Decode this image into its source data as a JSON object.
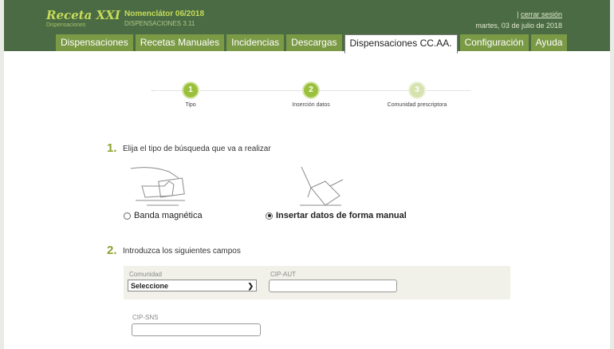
{
  "header": {
    "logo_text": "Receta XXI",
    "logo_sub": "Dispensaciones",
    "nomenclator": "Nomenclátor 06/2018",
    "app_version": "DISPENSACIONES 3.11",
    "separator": "|",
    "logout": "cerrar sesión",
    "date": "martes, 03 de julio de 2018"
  },
  "tabs": [
    {
      "label": "Dispensaciones"
    },
    {
      "label": "Recetas Manuales"
    },
    {
      "label": "Incidencias"
    },
    {
      "label": "Descargas"
    },
    {
      "label": "Dispensaciones CC.AA."
    },
    {
      "label": "Configuración"
    },
    {
      "label": "Ayuda"
    }
  ],
  "stepper": {
    "steps": [
      {
        "number": "1",
        "label": "Tipo"
      },
      {
        "number": "2",
        "label": "Inserción datos"
      },
      {
        "number": "3",
        "label": "Comunidad prescriptora"
      }
    ]
  },
  "section1": {
    "number": "1.",
    "title": "Elija el tipo de búsqueda que va a realizar",
    "option_magnetic": "Banda magnética",
    "option_manual": "Insertar datos de forma manual",
    "selected": "manual"
  },
  "section2": {
    "number": "2.",
    "title": "Introduzca los siguientes campos",
    "comunidad_label": "Comunidad",
    "comunidad_value": "Seleccione",
    "cip_aut_label": "CIP-AUT",
    "cip_aut_value": "",
    "cip_sns_label": "CIP-SNS",
    "cip_sns_value": ""
  },
  "colors": {
    "header_bg": "#4a6b43",
    "tab_bg": "#7b9a46",
    "accent_green": "#9bc13c",
    "logo_green": "#c6dc5a"
  }
}
